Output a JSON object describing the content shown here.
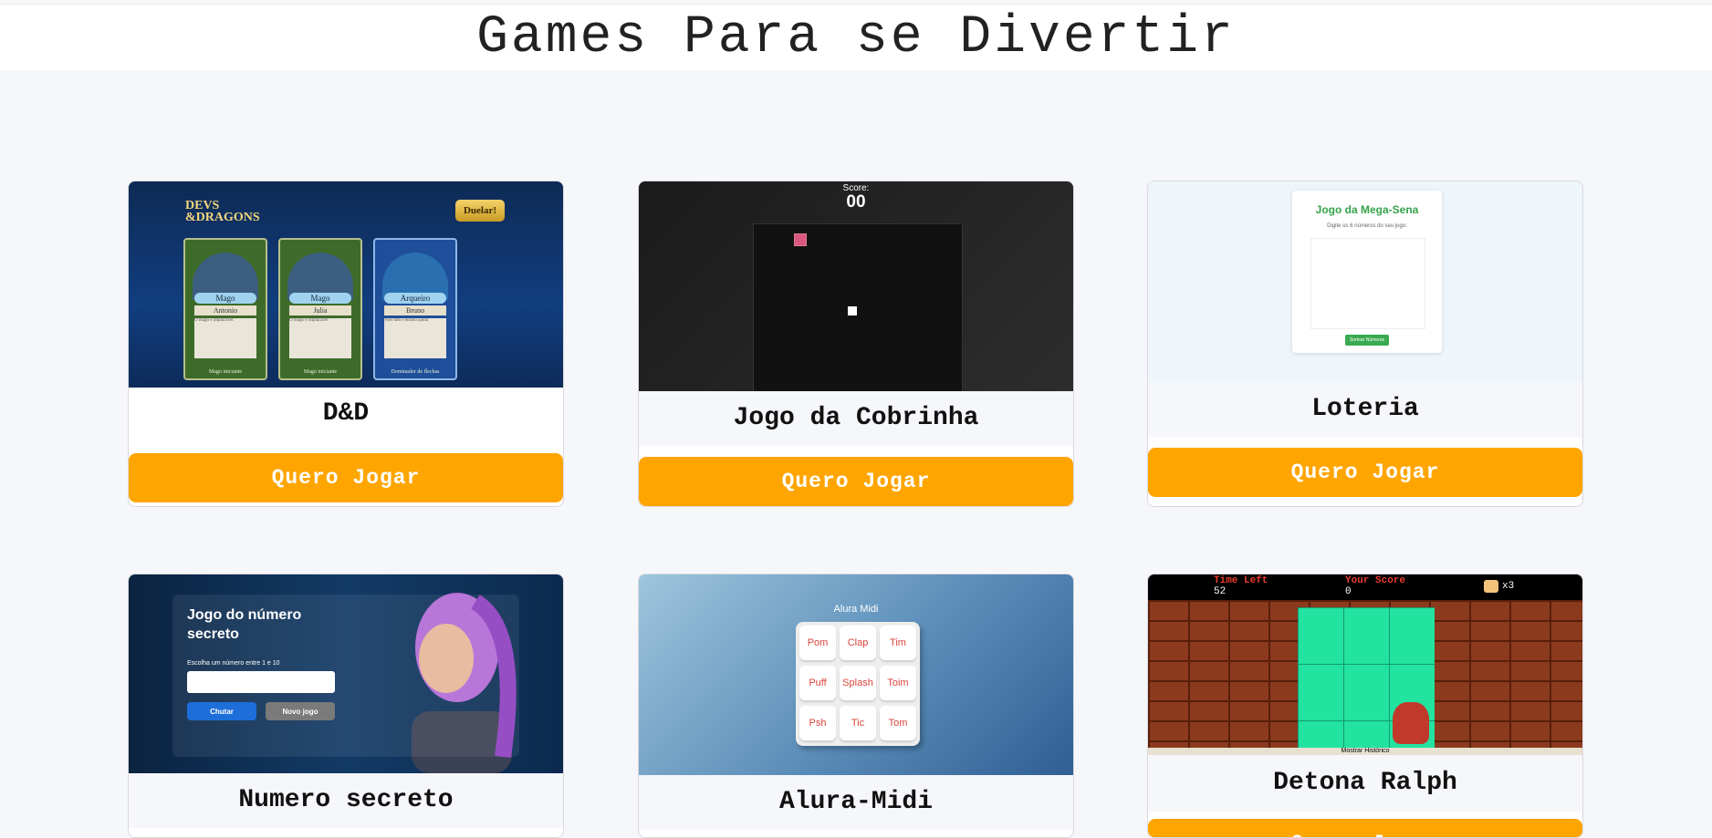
{
  "page": {
    "title": "Games Para se Divertir"
  },
  "button_label": "Quero Jogar",
  "colors": {
    "accent": "#ffa500",
    "background": "#f6f7fb"
  },
  "games": [
    {
      "title": "D&D",
      "preview": {
        "logo": "DEVS &DRAGONS",
        "action": "Duelar!",
        "cards": [
          {
            "class": "Mago",
            "name": "Antonio",
            "text": "O mago é implacável",
            "footer": "Mago iniciante"
          },
          {
            "class": "Mago",
            "name": "Julia",
            "text": "O mago é implacável",
            "footer": "Mago iniciante"
          },
          {
            "class": "Arqueiro",
            "name": "Bruno",
            "text": "Voei tum é ensino ajuda",
            "footer": "Dominador de flechas"
          }
        ]
      }
    },
    {
      "title": "Jogo da Cobrinha",
      "preview": {
        "score_label": "Score:",
        "score_value": "00"
      }
    },
    {
      "title": "Loteria",
      "preview": {
        "heading": "Jogo da Mega-Sena",
        "subtitle": "Digite os 6 números do seu jogo:",
        "button": "Sortear Números"
      }
    },
    {
      "title": "Numero secreto",
      "preview": {
        "heading": "Jogo do número secreto",
        "label": "Escolha um número entre 1 e 10",
        "guess_button": "Chutar",
        "new_button": "Novo jogo"
      }
    },
    {
      "title": "Alura-Midi",
      "preview": {
        "heading": "Alura Midi",
        "keys": [
          "Pom",
          "Clap",
          "Tim",
          "Puff",
          "Splash",
          "Toim",
          "Psh",
          "Tic",
          "Tom"
        ]
      }
    },
    {
      "title": "Detona Ralph",
      "preview": {
        "time_label": "Time Left",
        "time_value": "52",
        "score_label": "Your Score",
        "score_value": "0",
        "lives": "x3",
        "footer": "Mostrar Histórico"
      }
    }
  ]
}
